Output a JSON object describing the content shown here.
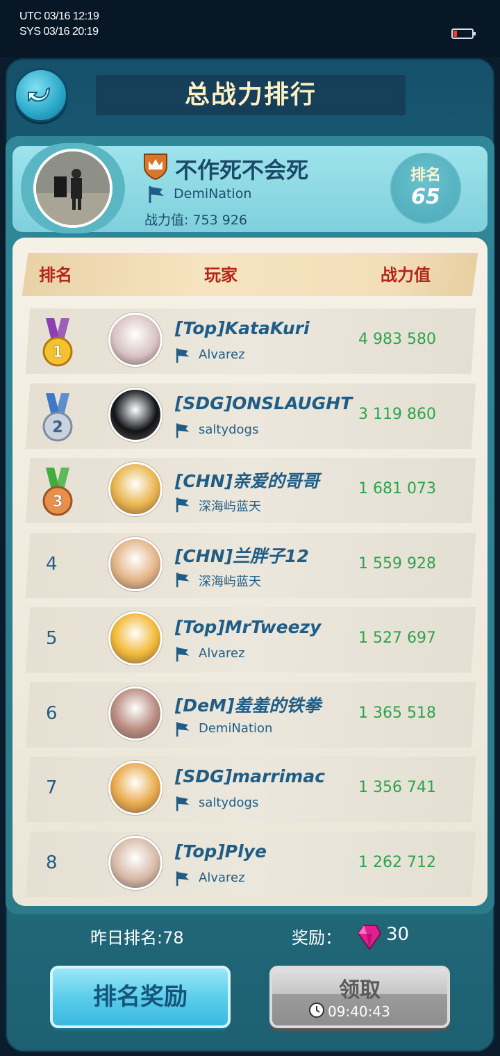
{
  "status_bar": {
    "utc": "UTC 03/16 12:19",
    "sys": "SYS 03/16 20:19",
    "battery_icon": "battery-low-icon"
  },
  "header": {
    "title": "总战力排行",
    "back_icon": "back-arrow-icon"
  },
  "me": {
    "name": "不作死不会死",
    "guild": "DemiNation",
    "power_label": "战力值: 753 926",
    "rank_label": "排名",
    "rank_value": "65",
    "badge_icon": "crown-shield-icon"
  },
  "columns": {
    "rank": "排名",
    "player": "玩家",
    "power": "战力值"
  },
  "rows": [
    {
      "rank": "1",
      "medal": "gold",
      "name": "[Top]KataKuri",
      "guild": "Alvarez",
      "power": "4 983 580",
      "avatar_color": "#d9c2c4"
    },
    {
      "rank": "2",
      "medal": "silver",
      "name": "[SDG]ONSLAUGHT",
      "guild": "saltydogs",
      "power": "3 119 860",
      "avatar_color": "#101318"
    },
    {
      "rank": "3",
      "medal": "bronze",
      "name": "[CHN]亲爱的哥哥",
      "guild": "深海屿蓝天",
      "power": "1 681 073",
      "avatar_color": "#e9b34a"
    },
    {
      "rank": "4",
      "medal": "",
      "name": "[CHN]兰胖子12",
      "guild": "深海屿蓝天",
      "power": "1 559 928",
      "avatar_color": "#e3b386"
    },
    {
      "rank": "5",
      "medal": "",
      "name": "[Top]MrTweezy",
      "guild": "Alvarez",
      "power": "1 527 697",
      "avatar_color": "#f1b733"
    },
    {
      "rank": "6",
      "medal": "",
      "name": "[DeM]羞羞的铁拳",
      "guild": "DemiNation",
      "power": "1 365 518",
      "avatar_color": "#b98b80"
    },
    {
      "rank": "7",
      "medal": "",
      "name": "[SDG]marrimac",
      "guild": "saltydogs",
      "power": "1 356 741",
      "avatar_color": "#e9a94a"
    },
    {
      "rank": "8",
      "medal": "",
      "name": "[Top]Plye",
      "guild": "Alvarez",
      "power": "1 262 712",
      "avatar_color": "#d7b9a6"
    }
  ],
  "footer": {
    "yesterday_rank": "昨日排名:78",
    "reward_label": "奖励：",
    "reward_amount": "30",
    "gem_icon": "gem-icon",
    "rank_reward_button": "排名奖励",
    "claim_button": "领取",
    "claim_timer": "09:40:43",
    "clock_icon": "clock-icon"
  }
}
